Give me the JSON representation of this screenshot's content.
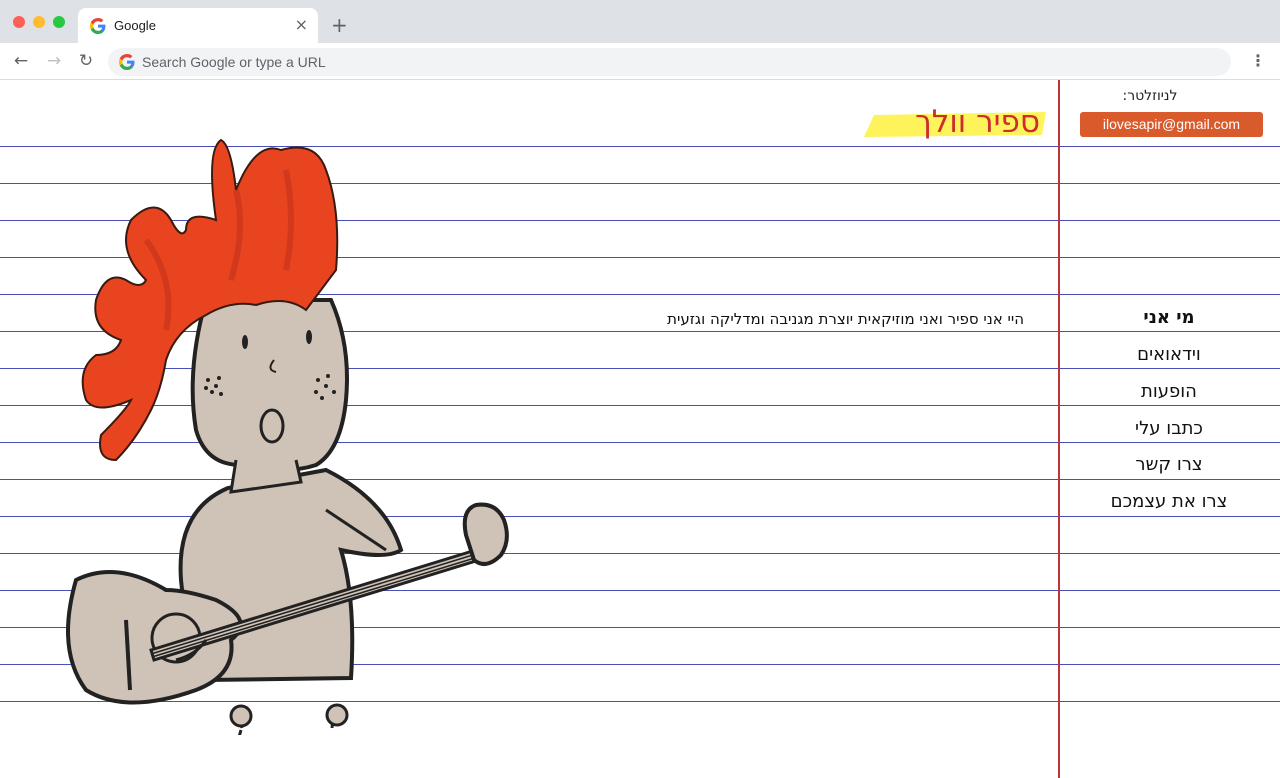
{
  "browser": {
    "tab_title": "Google",
    "tab_close": "×",
    "new_tab": "+",
    "back": "←",
    "forward": "→",
    "reload": "↻",
    "omnibox_placeholder": "Search Google or type a URL",
    "menu": "⋮"
  },
  "header": {
    "newsletter_label": "לניוזלטר:",
    "email": "ilovesapir@gmail.com",
    "site_title": "ספיר וולך"
  },
  "nav": {
    "items": [
      {
        "label": "מי אני",
        "active": true
      },
      {
        "label": "וידאואים"
      },
      {
        "label": "הופעות"
      },
      {
        "label": "כתבו עלי"
      },
      {
        "label": "צרו קשר"
      },
      {
        "label": "צרו את עצמכם"
      }
    ]
  },
  "main": {
    "bio": "היי אני ספיר ואני מוזיקאית יוצרת מגניבה ומדליקה וגזעית"
  },
  "colors": {
    "ruled_line": "#4a4fb8",
    "margin_line": "#b8363a",
    "title": "#cc2d2d",
    "highlight": "#fff35c",
    "email_button": "#d95a2b",
    "hair": "#e8441f"
  },
  "icons": {
    "favicon": "google-g-icon",
    "character": "singer-with-guitar-illustration"
  }
}
